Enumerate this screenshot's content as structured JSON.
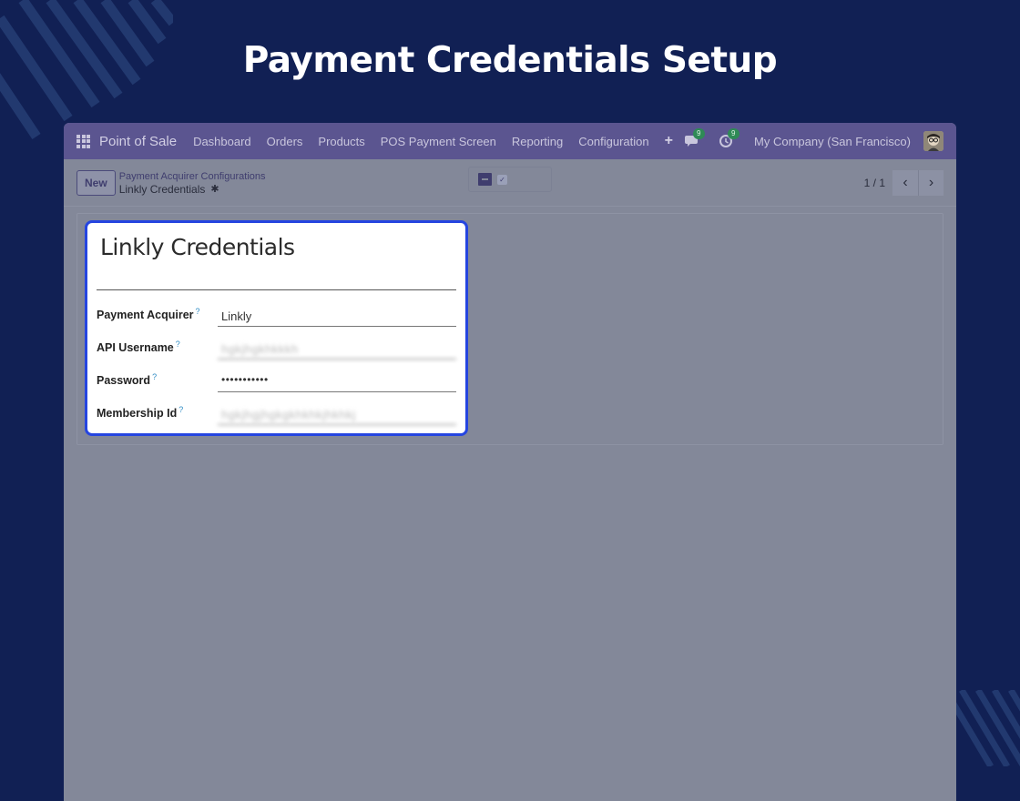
{
  "promo": {
    "title": "Payment Credentials Setup"
  },
  "navbar": {
    "app_name": "Point of Sale",
    "menu": [
      "Dashboard",
      "Orders",
      "Products",
      "POS Payment Screen",
      "Reporting",
      "Configuration"
    ],
    "plus": "+",
    "messages_count": "9",
    "activities_count": "9",
    "company": "My Company (San Francisco)"
  },
  "control_panel": {
    "new_label": "New",
    "breadcrumb_parent": "Payment Acquirer Configurations",
    "breadcrumb_current": "Linkly Credentials",
    "pager": "1 / 1"
  },
  "form": {
    "title": "Linkly Credentials",
    "fields": [
      {
        "label": "Payment Acquirer",
        "help": "?",
        "value": "Linkly"
      },
      {
        "label": "API Username",
        "help": "?",
        "value": "hgkjhgkhkkkh"
      },
      {
        "label": "Password",
        "help": "?",
        "value": "•••••••••••"
      },
      {
        "label": "Membership Id",
        "help": "?",
        "value": "hgkjhgjhgkgkhkhkjhkhkj"
      }
    ]
  },
  "colors": {
    "background": "#112054",
    "navbar": "#5b5590",
    "highlight_border": "#2545e0"
  }
}
